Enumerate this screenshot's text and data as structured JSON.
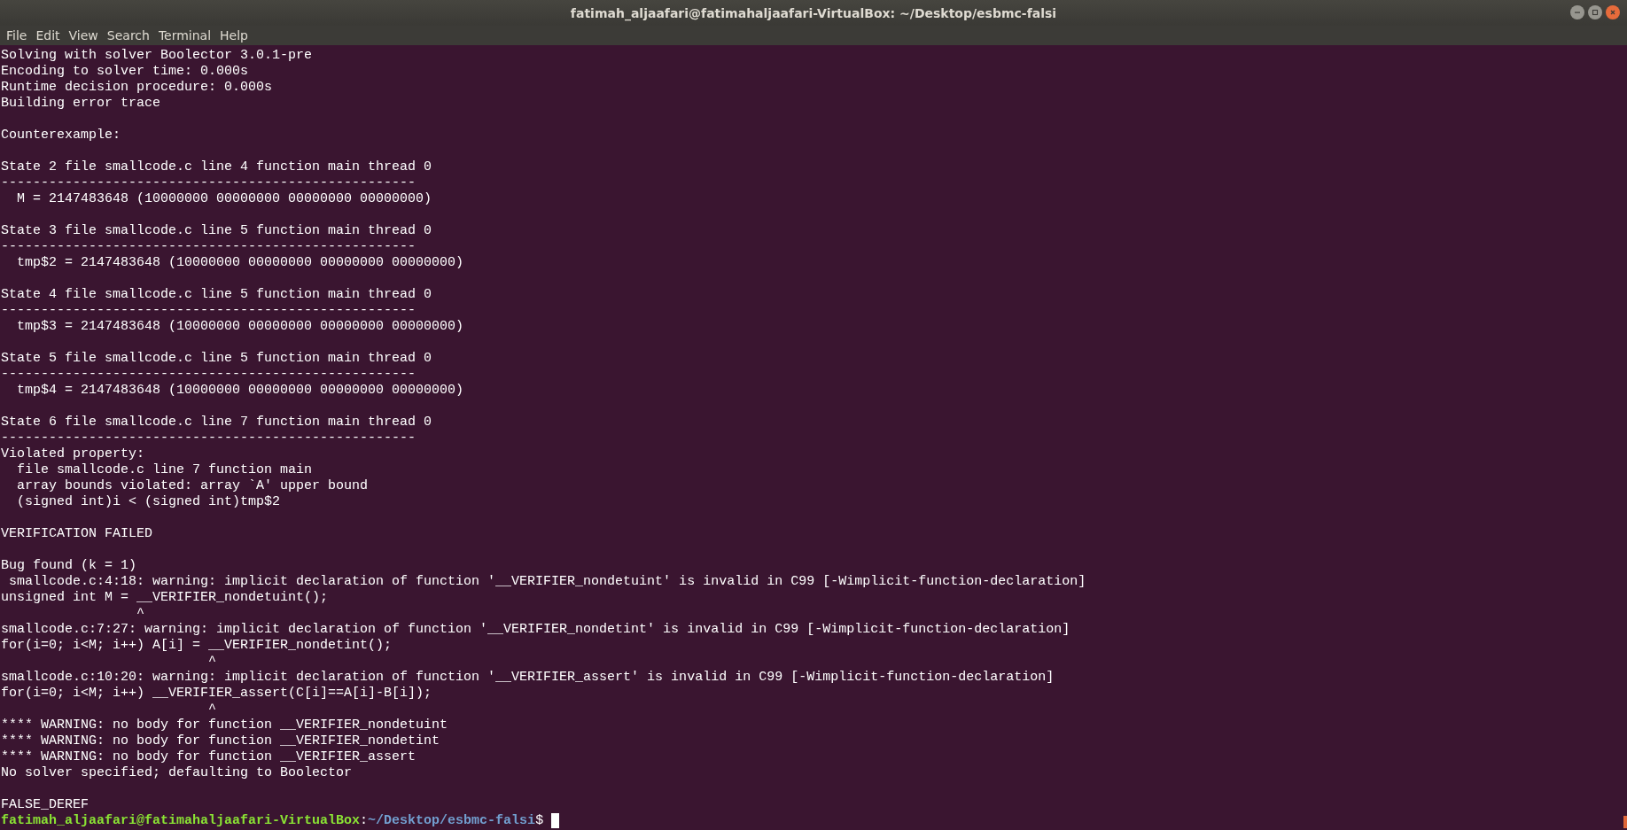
{
  "window": {
    "title": "fatimah_aljaafari@fatimahaljaafari-VirtualBox: ~/Desktop/esbmc-falsi"
  },
  "menu": [
    "File",
    "Edit",
    "View",
    "Search",
    "Terminal",
    "Help"
  ],
  "lines": [
    {
      "kind": "output",
      "text": "Solving with solver Boolector 3.0.1-pre"
    },
    {
      "kind": "output",
      "text": "Encoding to solver time: 0.000s"
    },
    {
      "kind": "output",
      "text": "Runtime decision procedure: 0.000s"
    },
    {
      "kind": "output",
      "text": "Building error trace"
    },
    {
      "kind": "blank"
    },
    {
      "kind": "output",
      "text": "Counterexample:"
    },
    {
      "kind": "blank"
    },
    {
      "kind": "output",
      "text": "State 2 file smallcode.c line 4 function main thread 0"
    },
    {
      "kind": "output",
      "text": "----------------------------------------------------"
    },
    {
      "kind": "output",
      "text": "  M = 2147483648 (10000000 00000000 00000000 00000000)"
    },
    {
      "kind": "blank"
    },
    {
      "kind": "output",
      "text": "State 3 file smallcode.c line 5 function main thread 0"
    },
    {
      "kind": "output",
      "text": "----------------------------------------------------"
    },
    {
      "kind": "output",
      "text": "  tmp$2 = 2147483648 (10000000 00000000 00000000 00000000)"
    },
    {
      "kind": "blank"
    },
    {
      "kind": "output",
      "text": "State 4 file smallcode.c line 5 function main thread 0"
    },
    {
      "kind": "output",
      "text": "----------------------------------------------------"
    },
    {
      "kind": "output",
      "text": "  tmp$3 = 2147483648 (10000000 00000000 00000000 00000000)"
    },
    {
      "kind": "blank"
    },
    {
      "kind": "output",
      "text": "State 5 file smallcode.c line 5 function main thread 0"
    },
    {
      "kind": "output",
      "text": "----------------------------------------------------"
    },
    {
      "kind": "output",
      "text": "  tmp$4 = 2147483648 (10000000 00000000 00000000 00000000)"
    },
    {
      "kind": "blank"
    },
    {
      "kind": "output",
      "text": "State 6 file smallcode.c line 7 function main thread 0"
    },
    {
      "kind": "output",
      "text": "----------------------------------------------------"
    },
    {
      "kind": "output",
      "text": "Violated property:"
    },
    {
      "kind": "output",
      "text": "  file smallcode.c line 7 function main"
    },
    {
      "kind": "output",
      "text": "  array bounds violated: array `A' upper bound"
    },
    {
      "kind": "output",
      "text": "  (signed int)i < (signed int)tmp$2"
    },
    {
      "kind": "blank"
    },
    {
      "kind": "output",
      "text": "VERIFICATION FAILED"
    },
    {
      "kind": "blank"
    },
    {
      "kind": "output",
      "text": "Bug found (k = 1)"
    },
    {
      "kind": "output",
      "text": " smallcode.c:4:18: warning: implicit declaration of function '__VERIFIER_nondetuint' is invalid in C99 [-Wimplicit-function-declaration]"
    },
    {
      "kind": "output",
      "text": "unsigned int M = __VERIFIER_nondetuint();"
    },
    {
      "kind": "output",
      "text": "                 ^"
    },
    {
      "kind": "output",
      "text": "smallcode.c:7:27: warning: implicit declaration of function '__VERIFIER_nondetint' is invalid in C99 [-Wimplicit-function-declaration]"
    },
    {
      "kind": "output",
      "text": "for(i=0; i<M; i++) A[i] = __VERIFIER_nondetint();"
    },
    {
      "kind": "output",
      "text": "                          ^"
    },
    {
      "kind": "output",
      "text": "smallcode.c:10:20: warning: implicit declaration of function '__VERIFIER_assert' is invalid in C99 [-Wimplicit-function-declaration]"
    },
    {
      "kind": "output",
      "text": "for(i=0; i<M; i++) __VERIFIER_assert(C[i]==A[i]-B[i]);"
    },
    {
      "kind": "output",
      "text": "                          ^"
    },
    {
      "kind": "output",
      "text": "**** WARNING: no body for function __VERIFIER_nondetuint"
    },
    {
      "kind": "output",
      "text": "**** WARNING: no body for function __VERIFIER_nondetint"
    },
    {
      "kind": "output",
      "text": "**** WARNING: no body for function __VERIFIER_assert"
    },
    {
      "kind": "output",
      "text": "No solver specified; defaulting to Boolector"
    },
    {
      "kind": "blank"
    },
    {
      "kind": "output",
      "text": "FALSE_DEREF"
    }
  ],
  "prompt": {
    "user_host": "fatimah_aljaafari@fatimahaljaafari-VirtualBox",
    "separator": ":",
    "path": "~/Desktop/esbmc-falsi",
    "symbol": "$"
  }
}
